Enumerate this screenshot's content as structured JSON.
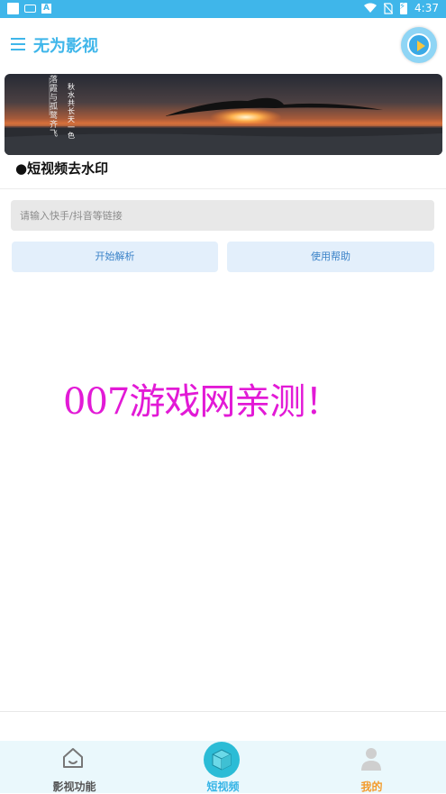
{
  "statusbar": {
    "time": "4:37",
    "battery_text": "⚡",
    "icons": [
      "wifi-icon",
      "no-sim-icon",
      "battery-icon"
    ]
  },
  "header": {
    "title": "无为影视",
    "menu_icon": "menu-icon",
    "play_icon": "play-circle-icon"
  },
  "banner": {
    "poem_left": "落霞与孤鹜齐飞",
    "poem_right": "秋水共长天一色"
  },
  "section": {
    "title": "●短视频去水印"
  },
  "form": {
    "url_placeholder": "请输入快手/抖音等链接",
    "url_value": "",
    "parse_label": "开始解析",
    "help_label": "使用帮助"
  },
  "watermark": {
    "text": "007游戏网亲测！"
  },
  "tabs": [
    {
      "label": "影视功能",
      "icon": "home-icon",
      "active": false
    },
    {
      "label": "短视频",
      "icon": "cube-icon",
      "active": true
    },
    {
      "label": "我的",
      "icon": "person-icon",
      "active": false
    }
  ],
  "colors": {
    "accent": "#3fb6ea",
    "button_bg": "#e3effb",
    "button_text": "#3a82c8",
    "watermark": "#e21ad6",
    "tab_mine": "#f39b2b",
    "tabbar_bg": "#eaf8fc"
  }
}
